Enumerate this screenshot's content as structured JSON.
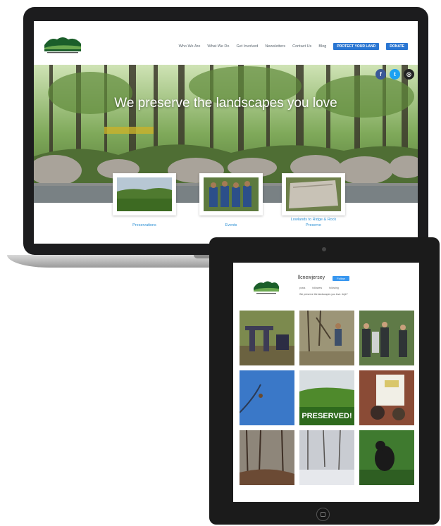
{
  "site": {
    "nav": [
      "Who We Are",
      "What We Do",
      "Get Involved",
      "Newsletters",
      "Contact Us",
      "Blog"
    ],
    "protect_button": "PROTECT YOUR LAND",
    "donate_button": "DONATE",
    "hero_title": "We preserve the landscapes you love",
    "social": [
      {
        "name": "facebook-icon",
        "glyph": "f",
        "color": "#3b5998"
      },
      {
        "name": "twitter-icon",
        "glyph": "t",
        "color": "#1da1f2"
      },
      {
        "name": "instagram-icon",
        "glyph": "◎",
        "color": "#222222"
      }
    ],
    "cards": [
      {
        "label": "Preservations"
      },
      {
        "label": "Events"
      },
      {
        "label": "Lowlands to Ridge & Rock",
        "label2": "Preserve"
      }
    ]
  },
  "instagram": {
    "username": "llcnewjersey",
    "follow_label": "Follow",
    "stats": [
      "posts",
      "followers",
      "following"
    ],
    "bio": "We preserve the landscapes you love. #njLT"
  },
  "tiles": [
    {
      "name": "photo-stone-bench"
    },
    {
      "name": "photo-tree-planting"
    },
    {
      "name": "photo-group-meeting"
    },
    {
      "name": "photo-bird-sky"
    },
    {
      "name": "photo-preserved-field",
      "text": "PRESERVED!"
    },
    {
      "name": "photo-presentation"
    },
    {
      "name": "photo-forest-path"
    },
    {
      "name": "photo-snowy-woods"
    },
    {
      "name": "photo-gorilla-statue"
    }
  ],
  "colors": {
    "accent": "#2a76d2",
    "link": "#2a8fd4",
    "device": "#1c1c1e"
  }
}
